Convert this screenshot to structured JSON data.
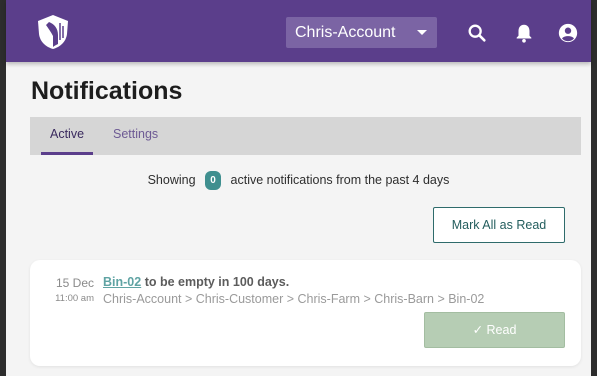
{
  "appbar": {
    "account_selected": "Chris-Account",
    "icons": [
      "shield-logo-icon",
      "search-icon",
      "bell-icon",
      "account-circle-icon"
    ]
  },
  "page": {
    "title": "Notifications"
  },
  "tabs": [
    {
      "label": "Active",
      "active": true
    },
    {
      "label": "Settings",
      "active": false
    }
  ],
  "summary": {
    "prefix": "Showing",
    "count": "0",
    "suffix": "active notifications from the past 4 days"
  },
  "mark_all_label": "Mark All as Read",
  "notifications": [
    {
      "date": "15 Dec",
      "time": "11:00 am",
      "link_text": "Bin-02",
      "message": "to be empty in 100 days.",
      "path": "Chris-Account > Chris-Customer > Chris-Farm > Chris-Barn > Bin-02",
      "read_label": "✓ Read"
    }
  ],
  "colors": {
    "brand": "#5b3e8b",
    "badge": "#3f8f8f",
    "read_button": "#b6cdb4",
    "link": "#5fa3a3"
  }
}
